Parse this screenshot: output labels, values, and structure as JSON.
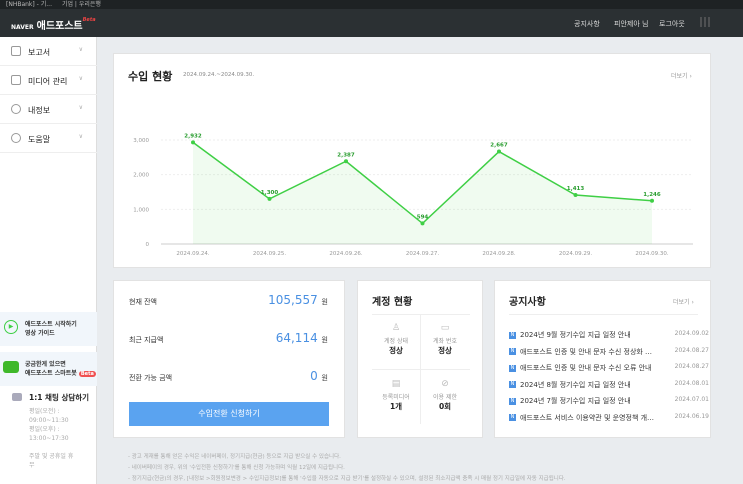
{
  "browser_tabs": [
    "[NHBank] - 기...",
    "기업 | 우리은행"
  ],
  "header": {
    "naver": "NAVER",
    "title": "애드포스트",
    "beta": "Beta",
    "links": [
      "공지사항",
      "피안제아 님",
      "로그아웃"
    ]
  },
  "sidebar": {
    "items": [
      {
        "label": "보고서",
        "icon": "chart-line-icon"
      },
      {
        "label": "미디어 관리",
        "icon": "document-icon"
      },
      {
        "label": "내정보",
        "icon": "user-icon"
      },
      {
        "label": "도움말",
        "icon": "headset-icon"
      }
    ],
    "guide": {
      "line1": "애드포스트 시작하기",
      "line2": "영상 가이드"
    },
    "bot": {
      "line1": "궁금한게 있으면",
      "line2": "애드포스트 스마트봇",
      "badge": "Beta"
    },
    "chat": {
      "title": "1:1 채팅 상담하기",
      "hours": [
        "평일(오전) :",
        "09:00~11:30",
        "평일(오후) :",
        "13:00~17:30",
        "",
        "주말 및 공휴일 휴",
        "무"
      ]
    }
  },
  "revenue": {
    "title": "수입 현황",
    "range": "2024.09.24.~2024.09.30.",
    "more": "더보기"
  },
  "chart_data": {
    "type": "line",
    "categories": [
      "2024.09.24.",
      "2024.09.25.",
      "2024.09.26.",
      "2024.09.27.",
      "2024.09.28.",
      "2024.09.29.",
      "2024.09.30."
    ],
    "values": [
      2932,
      1300,
      2387,
      594,
      2667,
      1413,
      1246
    ],
    "data_labels": [
      "2,932",
      "1,300",
      "2,387",
      "594",
      "2,667",
      "1,413",
      "1,246"
    ],
    "yticks": [
      "0",
      "1,000",
      "2,000",
      "3,000"
    ],
    "ylim": [
      0,
      3000
    ],
    "color": "#3fcf45",
    "grid": true
  },
  "balance": {
    "rows": [
      {
        "label": "현재 잔액",
        "value": "105,557",
        "unit": "원"
      },
      {
        "label": "최근 지급액",
        "value": "64,114",
        "unit": "원"
      },
      {
        "label": "전환 가능 금액",
        "value": "0",
        "unit": "원"
      }
    ],
    "button": "수입전환 신청하기"
  },
  "account": {
    "title": "계정 현황",
    "cells": [
      {
        "label": "계정 상태",
        "value": "정상",
        "icon": "user-icon"
      },
      {
        "label": "계좌 번호",
        "value": "정상",
        "icon": "card-icon"
      },
      {
        "label": "등록미디어",
        "value": "1개",
        "icon": "document-icon"
      },
      {
        "label": "이용 제한",
        "value": "0회",
        "icon": "ban-icon"
      }
    ]
  },
  "notices": {
    "title": "공지사항",
    "more": "더보기",
    "items": [
      {
        "text": "2024년 9월 정기수입 지급 일정 안내",
        "date": "2024.09.02"
      },
      {
        "text": "애드포스트 인증 및 안내 문자 수신 정상화 …",
        "date": "2024.08.27"
      },
      {
        "text": "애드포스트 인증 및 안내 문자 수신 오류 안내",
        "date": "2024.08.27"
      },
      {
        "text": "2024년 8월 정기수입 지급 일정 안내",
        "date": "2024.08.01"
      },
      {
        "text": "2024년 7월 정기수입 지급 일정 안내",
        "date": "2024.07.01"
      },
      {
        "text": "애드포스트 서비스 이용약관 및 운영정책 개…",
        "date": "2024.06.19"
      }
    ]
  },
  "footnotes": [
    "- 광고 게재를 통해 얻은 수익은 네이버페이, 정기지급(현금) 등으로 지급 받으실 수 있습니다.",
    "- 네이버페이의 경우, 위의 '수입전환 신청하기'를 통해 신청 가능하며 익월 12일에 지급됩니다.",
    "- 정기지급(현금)의 경우, [내정보 >회원정보변경 > 수입지급정보]를 통해 '수입을 자동으로 지급 받기'를 설정하실 수 있으며, 설정된 최소지급액 충족 시 매월 정기 지급일에 자동 지급됩니다."
  ]
}
